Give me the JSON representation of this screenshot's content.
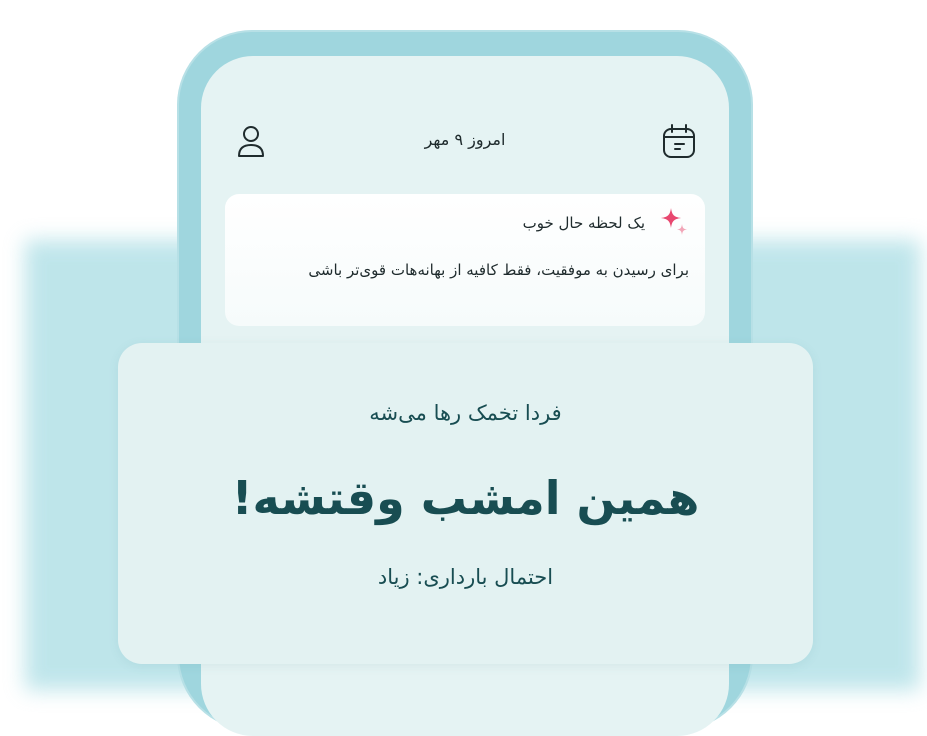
{
  "header": {
    "date_label": "امروز ۹ مهر"
  },
  "quote_card": {
    "title": "یک لحظه حال خوب",
    "text": "برای رسیدن به موفقیت، فقط کافیه از بهانه‌هات قوی‌تر باشی"
  },
  "info_card": {
    "subtitle": "فردا تخمک رها می‌شه",
    "headline": "همین امشب وقتشه!",
    "chance": "احتمال بارداری: زیاد"
  },
  "icons": {
    "calendar": "calendar-icon",
    "profile": "profile-icon",
    "sparkle": "sparkle-icon"
  },
  "colors": {
    "accent_dark": "#184d52",
    "frame": "#9fd6de",
    "screen": "#e5f3f3",
    "sparkle_primary": "#e8476f",
    "sparkle_secondary": "#f2a6b8"
  }
}
